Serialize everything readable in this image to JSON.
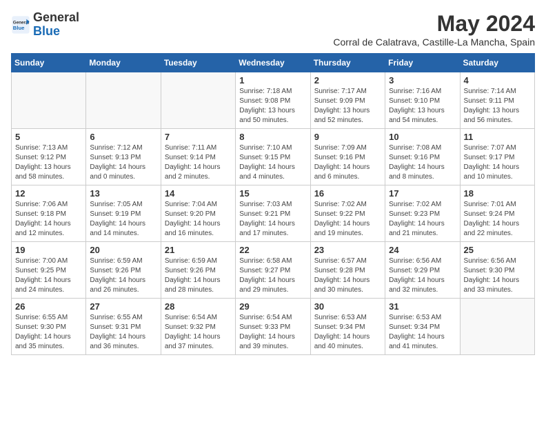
{
  "logo": {
    "general": "General",
    "blue": "Blue"
  },
  "title": "May 2024",
  "location": "Corral de Calatrava, Castille-La Mancha, Spain",
  "days_of_week": [
    "Sunday",
    "Monday",
    "Tuesday",
    "Wednesday",
    "Thursday",
    "Friday",
    "Saturday"
  ],
  "weeks": [
    [
      {
        "day": "",
        "empty": true
      },
      {
        "day": "",
        "empty": true
      },
      {
        "day": "",
        "empty": true
      },
      {
        "day": "1",
        "sunrise": "Sunrise: 7:18 AM",
        "sunset": "Sunset: 9:08 PM",
        "daylight": "Daylight: 13 hours and 50 minutes."
      },
      {
        "day": "2",
        "sunrise": "Sunrise: 7:17 AM",
        "sunset": "Sunset: 9:09 PM",
        "daylight": "Daylight: 13 hours and 52 minutes."
      },
      {
        "day": "3",
        "sunrise": "Sunrise: 7:16 AM",
        "sunset": "Sunset: 9:10 PM",
        "daylight": "Daylight: 13 hours and 54 minutes."
      },
      {
        "day": "4",
        "sunrise": "Sunrise: 7:14 AM",
        "sunset": "Sunset: 9:11 PM",
        "daylight": "Daylight: 13 hours and 56 minutes."
      }
    ],
    [
      {
        "day": "5",
        "sunrise": "Sunrise: 7:13 AM",
        "sunset": "Sunset: 9:12 PM",
        "daylight": "Daylight: 13 hours and 58 minutes."
      },
      {
        "day": "6",
        "sunrise": "Sunrise: 7:12 AM",
        "sunset": "Sunset: 9:13 PM",
        "daylight": "Daylight: 14 hours and 0 minutes."
      },
      {
        "day": "7",
        "sunrise": "Sunrise: 7:11 AM",
        "sunset": "Sunset: 9:14 PM",
        "daylight": "Daylight: 14 hours and 2 minutes."
      },
      {
        "day": "8",
        "sunrise": "Sunrise: 7:10 AM",
        "sunset": "Sunset: 9:15 PM",
        "daylight": "Daylight: 14 hours and 4 minutes."
      },
      {
        "day": "9",
        "sunrise": "Sunrise: 7:09 AM",
        "sunset": "Sunset: 9:16 PM",
        "daylight": "Daylight: 14 hours and 6 minutes."
      },
      {
        "day": "10",
        "sunrise": "Sunrise: 7:08 AM",
        "sunset": "Sunset: 9:16 PM",
        "daylight": "Daylight: 14 hours and 8 minutes."
      },
      {
        "day": "11",
        "sunrise": "Sunrise: 7:07 AM",
        "sunset": "Sunset: 9:17 PM",
        "daylight": "Daylight: 14 hours and 10 minutes."
      }
    ],
    [
      {
        "day": "12",
        "sunrise": "Sunrise: 7:06 AM",
        "sunset": "Sunset: 9:18 PM",
        "daylight": "Daylight: 14 hours and 12 minutes."
      },
      {
        "day": "13",
        "sunrise": "Sunrise: 7:05 AM",
        "sunset": "Sunset: 9:19 PM",
        "daylight": "Daylight: 14 hours and 14 minutes."
      },
      {
        "day": "14",
        "sunrise": "Sunrise: 7:04 AM",
        "sunset": "Sunset: 9:20 PM",
        "daylight": "Daylight: 14 hours and 16 minutes."
      },
      {
        "day": "15",
        "sunrise": "Sunrise: 7:03 AM",
        "sunset": "Sunset: 9:21 PM",
        "daylight": "Daylight: 14 hours and 17 minutes."
      },
      {
        "day": "16",
        "sunrise": "Sunrise: 7:02 AM",
        "sunset": "Sunset: 9:22 PM",
        "daylight": "Daylight: 14 hours and 19 minutes."
      },
      {
        "day": "17",
        "sunrise": "Sunrise: 7:02 AM",
        "sunset": "Sunset: 9:23 PM",
        "daylight": "Daylight: 14 hours and 21 minutes."
      },
      {
        "day": "18",
        "sunrise": "Sunrise: 7:01 AM",
        "sunset": "Sunset: 9:24 PM",
        "daylight": "Daylight: 14 hours and 22 minutes."
      }
    ],
    [
      {
        "day": "19",
        "sunrise": "Sunrise: 7:00 AM",
        "sunset": "Sunset: 9:25 PM",
        "daylight": "Daylight: 14 hours and 24 minutes."
      },
      {
        "day": "20",
        "sunrise": "Sunrise: 6:59 AM",
        "sunset": "Sunset: 9:26 PM",
        "daylight": "Daylight: 14 hours and 26 minutes."
      },
      {
        "day": "21",
        "sunrise": "Sunrise: 6:59 AM",
        "sunset": "Sunset: 9:26 PM",
        "daylight": "Daylight: 14 hours and 28 minutes."
      },
      {
        "day": "22",
        "sunrise": "Sunrise: 6:58 AM",
        "sunset": "Sunset: 9:27 PM",
        "daylight": "Daylight: 14 hours and 29 minutes."
      },
      {
        "day": "23",
        "sunrise": "Sunrise: 6:57 AM",
        "sunset": "Sunset: 9:28 PM",
        "daylight": "Daylight: 14 hours and 30 minutes."
      },
      {
        "day": "24",
        "sunrise": "Sunrise: 6:56 AM",
        "sunset": "Sunset: 9:29 PM",
        "daylight": "Daylight: 14 hours and 32 minutes."
      },
      {
        "day": "25",
        "sunrise": "Sunrise: 6:56 AM",
        "sunset": "Sunset: 9:30 PM",
        "daylight": "Daylight: 14 hours and 33 minutes."
      }
    ],
    [
      {
        "day": "26",
        "sunrise": "Sunrise: 6:55 AM",
        "sunset": "Sunset: 9:30 PM",
        "daylight": "Daylight: 14 hours and 35 minutes."
      },
      {
        "day": "27",
        "sunrise": "Sunrise: 6:55 AM",
        "sunset": "Sunset: 9:31 PM",
        "daylight": "Daylight: 14 hours and 36 minutes."
      },
      {
        "day": "28",
        "sunrise": "Sunrise: 6:54 AM",
        "sunset": "Sunset: 9:32 PM",
        "daylight": "Daylight: 14 hours and 37 minutes."
      },
      {
        "day": "29",
        "sunrise": "Sunrise: 6:54 AM",
        "sunset": "Sunset: 9:33 PM",
        "daylight": "Daylight: 14 hours and 39 minutes."
      },
      {
        "day": "30",
        "sunrise": "Sunrise: 6:53 AM",
        "sunset": "Sunset: 9:34 PM",
        "daylight": "Daylight: 14 hours and 40 minutes."
      },
      {
        "day": "31",
        "sunrise": "Sunrise: 6:53 AM",
        "sunset": "Sunset: 9:34 PM",
        "daylight": "Daylight: 14 hours and 41 minutes."
      },
      {
        "day": "",
        "empty": true
      }
    ]
  ]
}
